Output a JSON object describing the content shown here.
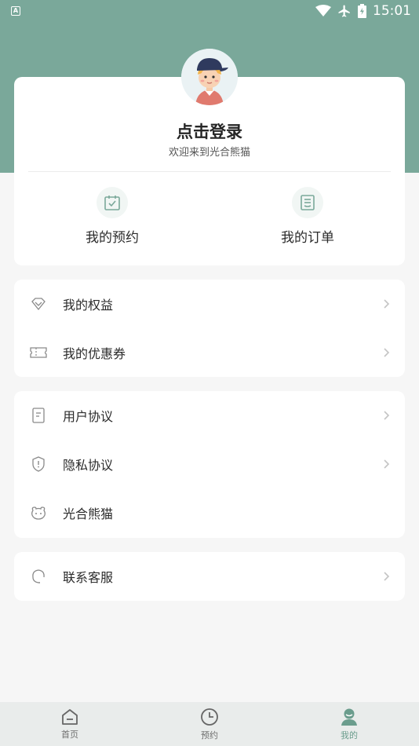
{
  "status_bar": {
    "left_icon": "A",
    "time": "15:01",
    "icons": [
      "wifi-icon",
      "airplane-icon",
      "battery-icon"
    ]
  },
  "colors": {
    "header": "#7aa89a",
    "accent": "#6b9d8d",
    "background": "#f6f6f6"
  },
  "profile": {
    "title": "点击登录",
    "subtitle": "欢迎来到光合熊猫",
    "avatar_icon": "user-avatar-icon"
  },
  "quick_actions": [
    {
      "label": "我的预约",
      "icon": "calendar-check-icon"
    },
    {
      "label": "我的订单",
      "icon": "order-list-icon"
    }
  ],
  "menu_groups": [
    [
      {
        "label": "我的权益",
        "icon": "diamond-icon",
        "chevron": true
      },
      {
        "label": "我的优惠券",
        "icon": "ticket-icon",
        "chevron": true
      }
    ],
    [
      {
        "label": "用户协议",
        "icon": "document-icon",
        "chevron": true
      },
      {
        "label": "隐私协议",
        "icon": "shield-icon",
        "chevron": true
      },
      {
        "label": "光合熊猫",
        "icon": "panda-icon",
        "chevron": false
      }
    ],
    [
      {
        "label": "联系客服",
        "icon": "headset-icon",
        "chevron": true
      }
    ]
  ],
  "bottom_nav": [
    {
      "label": "首页",
      "icon": "home-icon",
      "active": false
    },
    {
      "label": "预约",
      "icon": "clock-icon",
      "active": false
    },
    {
      "label": "我的",
      "icon": "profile-icon",
      "active": true
    }
  ]
}
